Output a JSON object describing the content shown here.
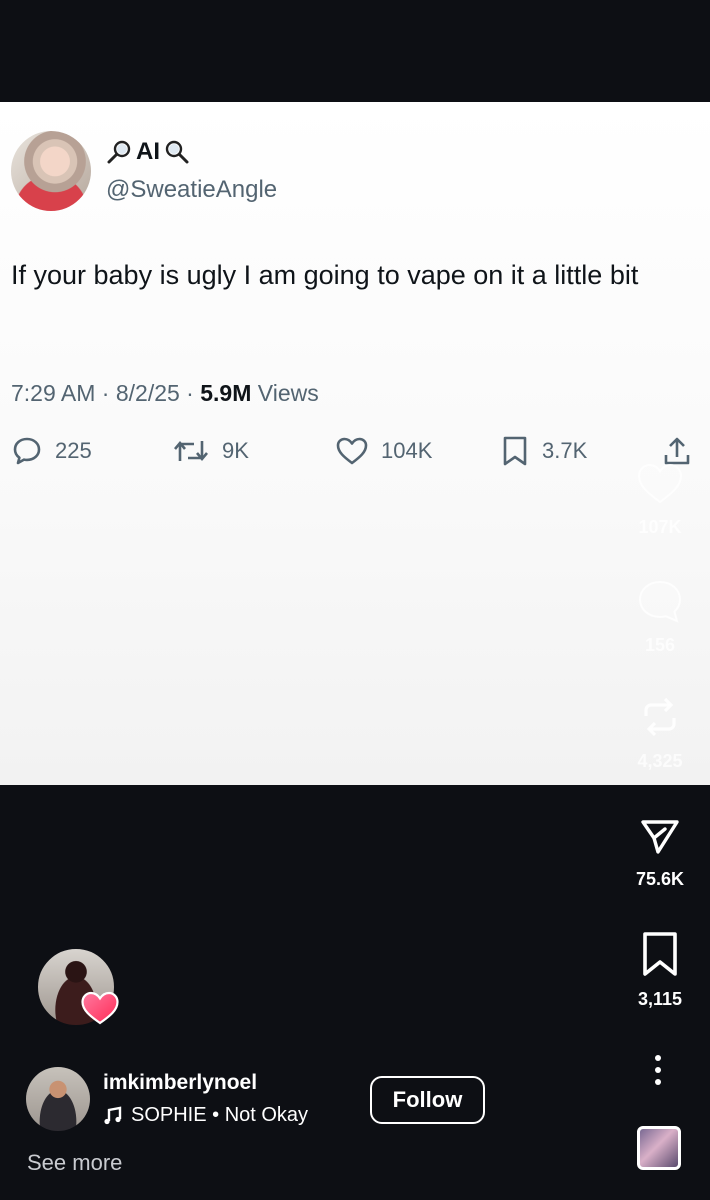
{
  "tweet": {
    "display_name": "AI",
    "handle": "@SweatieAngle",
    "text": "If your baby is ugly I am going to vape on it a little bit",
    "time": "7:29 AM",
    "date": "8/2/25",
    "views_count": "5.9M",
    "views_label": "Views",
    "replies": "225",
    "retweets": "9K",
    "likes": "104K",
    "bookmarks": "3.7K"
  },
  "sidebar": {
    "likes": "107K",
    "comments": "156",
    "reposts": "4,325",
    "shares": "75.6K",
    "saves": "3,115"
  },
  "post": {
    "username": "imkimberlynoel",
    "music": "SOPHIE • Not Okay",
    "follow_label": "Follow",
    "see_more": "See more"
  },
  "colors": {
    "background": "#0d0f14",
    "heart_badge": "#ff3d67",
    "tweet_secondary": "#536471"
  }
}
